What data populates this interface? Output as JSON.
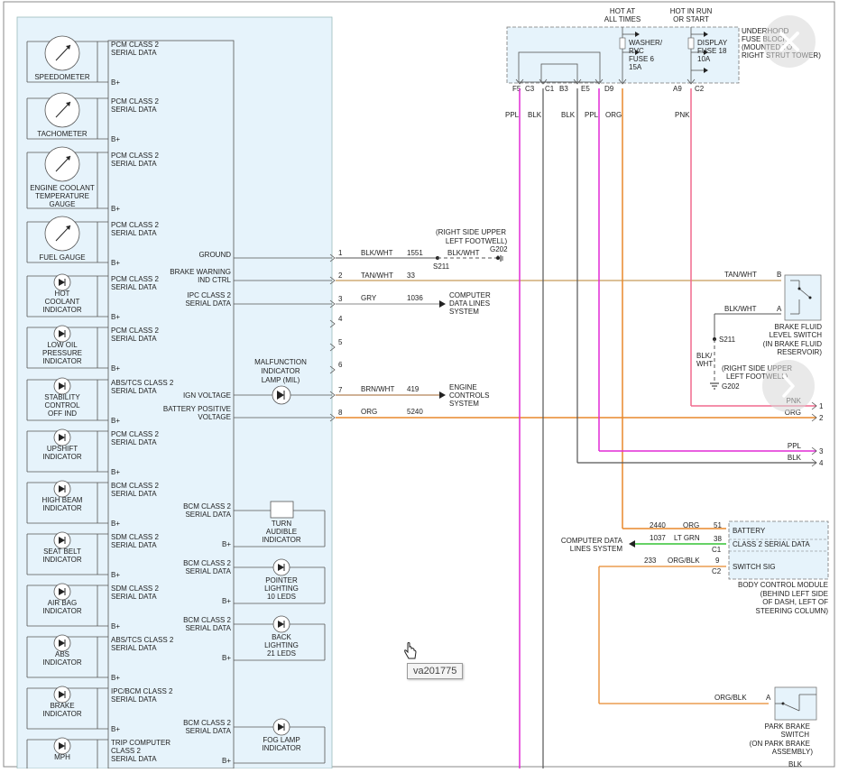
{
  "viewer": {
    "image_id": "va201775",
    "close_icon": "close-icon",
    "next_icon": "chevron-right-icon"
  },
  "colors": {
    "panel_bg": "#e6f3fb",
    "ppl": "#e22bd6",
    "org": "#e8892c",
    "pnk": "#f06a8e",
    "tan": "#c89a5a",
    "grn": "#33c234",
    "blk": "#555555",
    "gry": "#8a8a8a"
  },
  "cluster": {
    "gauges": [
      {
        "label_lines": [
          "SPEEDOMETER"
        ],
        "data_lines": [
          "PCM CLASS 2",
          "SERIAL DATA"
        ],
        "bplus": "B+"
      },
      {
        "label_lines": [
          "TACHOMETER"
        ],
        "data_lines": [
          "PCM CLASS 2",
          "SERIAL DATA"
        ],
        "bplus": "B+"
      },
      {
        "label_lines": [
          "ENGINE COOLANT",
          "TEMPERATURE",
          "GAUGE"
        ],
        "data_lines": [
          "PCM CLASS 2",
          "SERIAL DATA"
        ],
        "bplus": "B+"
      },
      {
        "label_lines": [
          "FUEL GAUGE"
        ],
        "data_lines": [
          "PCM CLASS 2",
          "SERIAL DATA"
        ],
        "bplus": "B+"
      }
    ],
    "indicators": [
      {
        "label_lines": [
          "HOT",
          "COOLANT",
          "INDICATOR"
        ],
        "data_lines": [
          "PCM CLASS 2",
          "SERIAL DATA"
        ],
        "bplus": "B+"
      },
      {
        "label_lines": [
          "LOW OIL",
          "PRESSURE",
          "INDICATOR"
        ],
        "data_lines": [
          "PCM CLASS 2",
          "SERIAL DATA"
        ],
        "bplus": "B+"
      },
      {
        "label_lines": [
          "STABILITY",
          "CONTROL",
          "OFF IND"
        ],
        "data_lines": [
          "ABS/TCS CLASS 2",
          "SERIAL DATA"
        ],
        "bplus": "B+"
      },
      {
        "label_lines": [
          "UPSHIFT",
          "INDICATOR"
        ],
        "data_lines": [
          "PCM CLASS 2",
          "SERIAL DATA"
        ],
        "bplus": "B+"
      },
      {
        "label_lines": [
          "HIGH BEAM",
          "INDICATOR"
        ],
        "data_lines": [
          "BCM CLASS 2",
          "SERIAL DATA"
        ],
        "bplus": "B+"
      },
      {
        "label_lines": [
          "SEAT BELT",
          "INDICATOR"
        ],
        "data_lines": [
          "SDM CLASS 2",
          "SERIAL DATA"
        ],
        "bplus": "B+"
      },
      {
        "label_lines": [
          "AIR BAG",
          "INDICATOR"
        ],
        "data_lines": [
          "SDM CLASS 2",
          "SERIAL DATA"
        ],
        "bplus": "B+"
      },
      {
        "label_lines": [
          "ABS",
          "INDICATOR"
        ],
        "data_lines": [
          "ABS/TCS CLASS 2",
          "SERIAL DATA"
        ],
        "bplus": "B+"
      },
      {
        "label_lines": [
          "BRAKE",
          "INDICATOR"
        ],
        "data_lines": [
          "IPC/BCM CLASS 2",
          "SERIAL DATA"
        ],
        "bplus": "B+"
      },
      {
        "label_lines": [
          "MPH"
        ],
        "data_lines": [
          "TRIP COMPUTER",
          "CLASS 2",
          "SERIAL DATA"
        ],
        "bplus": ""
      }
    ],
    "inner_modules": [
      {
        "label_lines": [
          "TURN",
          "AUDIBLE",
          "INDICATOR"
        ],
        "data_lines": [
          "BCM CLASS 2",
          "SERIAL DATA"
        ],
        "bplus": "B+"
      },
      {
        "label_lines": [
          "POINTER",
          "LIGHTING",
          "10 LEDS"
        ],
        "data_lines": [
          "BCM CLASS 2",
          "SERIAL DATA"
        ],
        "bplus": "B+"
      },
      {
        "label_lines": [
          "BACK",
          "LIGHTING",
          "21 LEDS"
        ],
        "data_lines": [
          "BCM CLASS 2",
          "SERIAL DATA"
        ],
        "bplus": "B+"
      },
      {
        "label_lines": [
          "FOG LAMP",
          "INDICATOR"
        ],
        "data_lines": [
          "BCM CLASS 2",
          "SERIAL DATA"
        ],
        "bplus": "B+"
      }
    ],
    "mil": {
      "label_lines": [
        "MALFUNCTION",
        "INDICATOR",
        "LAMP (MIL)"
      ],
      "ign": "IGN VOLTAGE"
    },
    "pins_left": [
      {
        "lines": [
          "GROUND"
        ]
      },
      {
        "lines": [
          "BRAKE WARNING",
          "IND CTRL"
        ]
      },
      {
        "lines": [
          "IPC CLASS 2",
          "SERIAL DATA"
        ]
      },
      {
        "lines": [
          "BATTERY POSITIVE",
          "VOLTAGE"
        ]
      }
    ],
    "pin_numbers": [
      "1",
      "2",
      "3",
      "4",
      "5",
      "6",
      "7",
      "8"
    ]
  },
  "wires": {
    "w1": {
      "color": "BLK/WHT",
      "circuit": "1551",
      "splice": "S211",
      "ground": "G202",
      "ground_lines": [
        "(RIGHT SIDE UPPER",
        "LEFT FOOTWELL)"
      ],
      "color2": "BLK/WHT"
    },
    "w2": {
      "color": "TAN/WHT",
      "circuit": "33"
    },
    "w3": {
      "color": "GRY",
      "circuit": "1036",
      "dest_lines": [
        "COMPUTER",
        "DATA LINES",
        "SYSTEM"
      ]
    },
    "w7": {
      "color": "BRN/WHT",
      "circuit": "419",
      "dest_lines": [
        "ENGINE",
        "CONTROLS",
        "SYSTEM"
      ]
    },
    "w8": {
      "color": "ORG",
      "circuit": "5240"
    }
  },
  "fuse_block": {
    "hot_at_all_times_lines": [
      "HOT AT",
      "ALL TIMES"
    ],
    "hot_in_run_lines": [
      "HOT IN RUN",
      "OR START"
    ],
    "washer_fuse_lines": [
      "WASHER/",
      "RVC",
      "FUSE 6",
      "15A"
    ],
    "display_fuse_lines": [
      "DISPLAY",
      "FUSE 18",
      "10A"
    ],
    "title_lines": [
      "UNDERHOOD",
      "FUSE BLOCK",
      "(MOUNTED TO",
      "RIGHT STRUT TOWER)"
    ],
    "terminals": [
      "F5",
      "C3",
      "C1",
      "B3",
      "E5",
      "D9",
      "A9",
      "C2"
    ],
    "wire_colors": [
      "PPL",
      "BLK",
      "BLK",
      "PPL",
      "ORG",
      "PNK"
    ]
  },
  "brake_fluid_switch": {
    "label_lines": [
      "BRAKE FLUID",
      "LEVEL SWITCH",
      "(IN BRAKE FLUID",
      "RESERVOIR)"
    ],
    "wire_b": "TAN/WHT",
    "pin_b": "B",
    "wire_a": "BLK/WHT",
    "pin_a": "A",
    "splice": "S211",
    "vert_wire_lines": [
      "BLK/",
      "WHT"
    ],
    "ground_lines": [
      "(RIGHT SIDE UPPER",
      "LEFT FOOTWELL)"
    ],
    "ground": "G202"
  },
  "right_pins": [
    {
      "color": "PNK",
      "pin": "1"
    },
    {
      "color": "ORG",
      "pin": "2"
    },
    {
      "color": "PPL",
      "pin": "3"
    },
    {
      "color": "BLK",
      "pin": "4"
    }
  ],
  "bcm": {
    "pins": [
      "BATTERY",
      "CLASS 2 SERIAL DATA",
      "SWITCH SIG"
    ],
    "connectors": [
      "51",
      "38",
      "9"
    ],
    "connector_ids": [
      "C1",
      "C2"
    ],
    "title_lines": [
      "BODY CONTROL MODULE",
      "(BEHIND LEFT SIDE",
      "OF DASH, LEFT OF",
      "STEERING COLUMN)"
    ],
    "wire_batt": {
      "circuit": "2440",
      "color": "ORG"
    },
    "wire_data": {
      "circuit": "1037",
      "color": "LT GRN"
    },
    "wire_sw": {
      "circuit": "233",
      "color": "ORG/BLK"
    },
    "data_dest_lines": [
      "COMPUTER DATA",
      "LINES SYSTEM"
    ]
  },
  "park_brake": {
    "label_lines": [
      "PARK BRAKE",
      "SWITCH",
      "(ON PARK BRAKE",
      "ASSEMBLY)"
    ],
    "wire": "ORG/BLK",
    "pin": "A",
    "bottom_wire": "BLK"
  }
}
